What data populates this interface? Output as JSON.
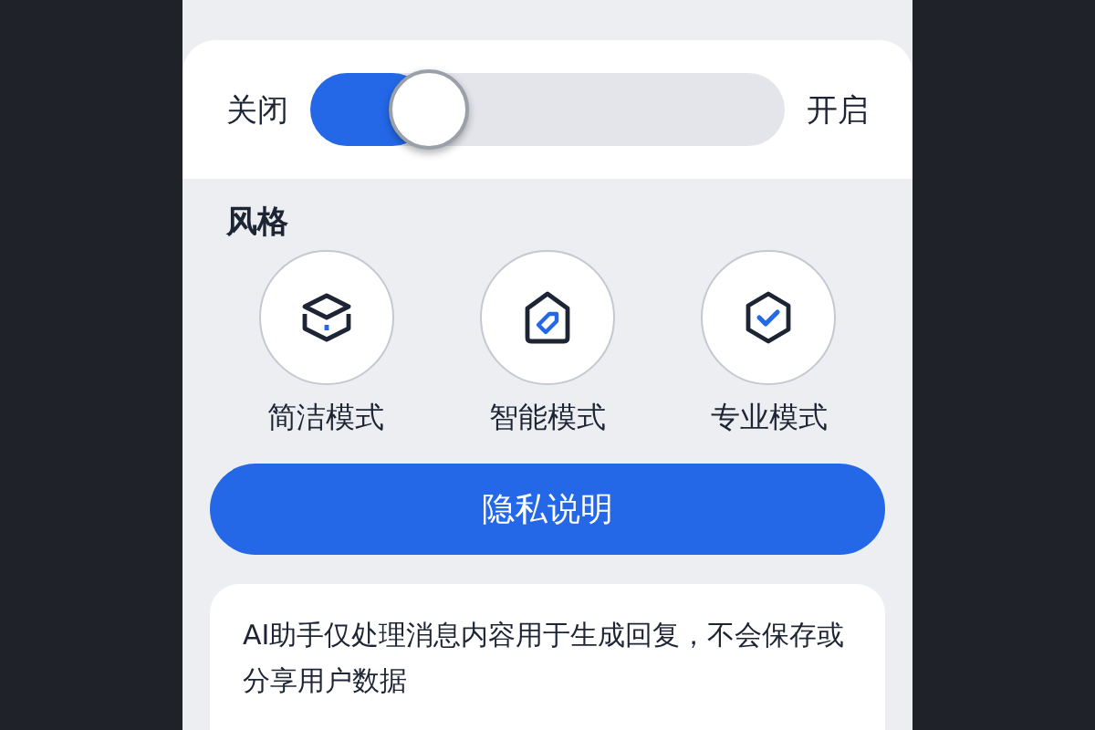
{
  "toggle": {
    "off_label": "关闭",
    "on_label": "开启",
    "level": 0.2
  },
  "style_section": {
    "title": "风格",
    "modes": [
      {
        "kind": "box",
        "label": "简洁模式"
      },
      {
        "kind": "tag",
        "label": "智能模式"
      },
      {
        "kind": "check",
        "label": "专业模式"
      }
    ]
  },
  "privacy_button": {
    "label": "隐私说明"
  },
  "info_card": {
    "text": "AI助手仅处理消息内容用于生成回复，不会保存或分享用户数据"
  }
}
